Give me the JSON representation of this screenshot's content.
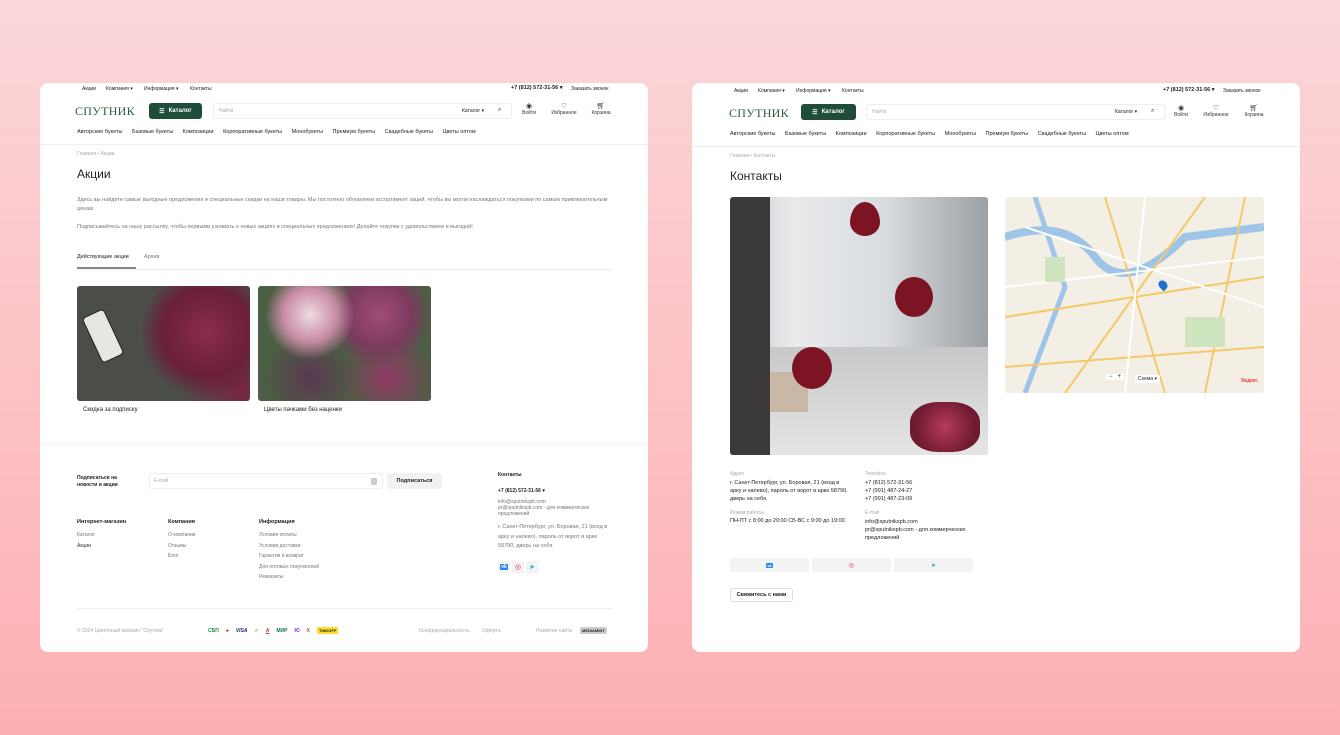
{
  "header": {
    "top_links": [
      "Акции",
      "Компания ▾",
      "Информация ▾",
      "Контакты"
    ],
    "phone": "+7 (812) 572-31-56 ▾",
    "callback": "Заказать звонок",
    "logo": "СПУТНИК",
    "catalog_button": "Каталог",
    "search_placeholder": "Найти",
    "search_scope": "Каталог ▾",
    "icons": [
      {
        "icon": "user-icon",
        "label": "Войти"
      },
      {
        "icon": "heart-icon",
        "label": "Избранное"
      },
      {
        "icon": "cart-icon",
        "label": "Корзина"
      }
    ],
    "nav": [
      "Авторские букеты",
      "Базовые букеты",
      "Композиции",
      "Корпоративные букеты",
      "Монобукеты",
      "Премиум букеты",
      "Свадебные букеты",
      "Цветы оптом"
    ]
  },
  "promo_page": {
    "breadcrumb": [
      "Главная",
      "Акции"
    ],
    "title": "Акции",
    "paragraph1": "Здесь вы найдете самые выгодные предложения и специальные скидки на наши товары. Мы постоянно обновляем ассортимент акций, чтобы вы могли наслаждаться покупками по самым привлекательным ценам.",
    "paragraph2": "Подписывайтесь на нашу рассылку, чтобы первыми узнавать о новых акциях и специальных предложениях! Делайте покупки с удовольствием и выгодой!",
    "tabs": [
      "Действующие акции",
      "Архив"
    ],
    "cards": [
      "Скидка за подписку",
      "Цветы пачками без наценки"
    ]
  },
  "footer": {
    "subscribe_label": "Подписаться на новости и акции",
    "email_placeholder": "E-mail",
    "subscribe_button": "Подписаться",
    "columns": [
      {
        "title": "Интернет-магазин",
        "links": [
          "Каталог",
          "Акции"
        ]
      },
      {
        "title": "Компания",
        "links": [
          "О компании",
          "Отзывы",
          "Блог"
        ]
      },
      {
        "title": "Информация",
        "links": [
          "Условия оплаты",
          "Условия доставки",
          "Гарантия и возврат",
          "Для оптовых покупателей",
          "Реквизиты"
        ]
      }
    ],
    "contacts_title": "Контакты",
    "phone": "+7 (812) 572-31-56 ▾",
    "email1": "info@sputnikspb.com",
    "email2": "pr@sputnikspb.com - для коммерческих предложений",
    "address": "г. Санкт-Петербург, ул. Боровая, 21 (вход в арку и налево), пароль от ворот в арке 58790, дверь на себя.",
    "copyright": "© 2024 Цветочный магазин \"Спутник\"",
    "payments": [
      "СБП",
      "Mastercard",
      "VISA",
      "✓",
      "А",
      "МИР",
      "Ю",
      "X",
      "TINKOFF"
    ],
    "privacy": "Конфиденциальность",
    "offer": "Оферта",
    "dev": "Развитие сайта",
    "dev_logo": "MEDIAMINT"
  },
  "contacts_page": {
    "breadcrumb": [
      "Главная",
      "Контакты"
    ],
    "title": "Контакты",
    "address_label": "Адрес",
    "address": "г. Санкт-Петербург, ул. Боровая, 21 (вход в арку и налево), пароль от ворот в арке 58790, дверь на себя.",
    "hours_label": "Режим работы",
    "hours": "ПН-ПТ с 8:00 до 20:00 СБ-ВС с 9:00 до 19:00",
    "phone_label": "Телефон",
    "phones": [
      "+7 (812) 572-31-56",
      "+7 (991) 487-24-27",
      "+7 (991) 487-23-09"
    ],
    "email_label": "E-mail",
    "email1": "info@sputnikspb.com",
    "email2": "pr@sputnikspb.com - для коммерческих предложений",
    "contact_button": "Свяжитесь с нами",
    "map": {
      "zoom_minus": "−",
      "zoom_plus": "+",
      "layer": "Схема ▾",
      "brand": "Яндекс"
    }
  },
  "colors": {
    "accent": "#1e4d3a",
    "bg_top": "#fbd6d9",
    "bg_bottom": "#fdb0b3"
  }
}
